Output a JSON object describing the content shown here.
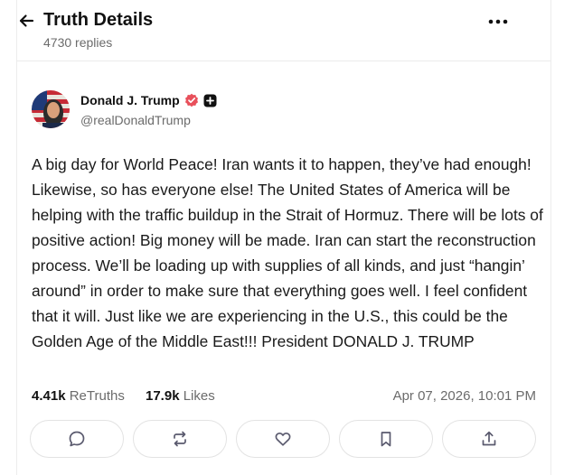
{
  "header": {
    "title": "Truth Details",
    "replies": "4730 replies",
    "back_icon": "arrow-left-icon",
    "more_icon": "more-horizontal-icon"
  },
  "author": {
    "name": "Donald J. Trump",
    "handle": "@realDonaldTrump",
    "verified_icon": "verified-badge-icon",
    "verified_color": "#e8505b",
    "plus_icon": "plus-badge-icon"
  },
  "post": {
    "text": "A big day for World Peace! Iran wants it to happen, they’ve had enough! Likewise, so has everyone else! The United States of America will be helping with the traffic buildup in the Strait of Hormuz. There will be lots of positive action! Big money will be made. Iran can start the reconstruction process. We’ll be loading up with supplies of all kinds, and just “hangin’ around” in order to make sure that everything goes well. I feel confident that it will. Just like we are experiencing in the U.S., this could be the Golden Age of the Middle East!!! President DONALD J. TRUMP",
    "retruths_count": "4.41k",
    "retruths_label": "ReTruths",
    "likes_count": "17.9k",
    "likes_label": "Likes",
    "timestamp": "Apr 07, 2026, 10:01 PM"
  },
  "actions": [
    {
      "name": "reply",
      "icon": "comment-icon"
    },
    {
      "name": "retruth",
      "icon": "repost-icon"
    },
    {
      "name": "like",
      "icon": "heart-icon"
    },
    {
      "name": "bookmark",
      "icon": "bookmark-icon"
    },
    {
      "name": "share",
      "icon": "share-icon"
    }
  ],
  "colors": {
    "text": "#111111",
    "muted": "#6b6b6b",
    "border": "#e3e3e3",
    "icon": "#5a5a6e"
  }
}
